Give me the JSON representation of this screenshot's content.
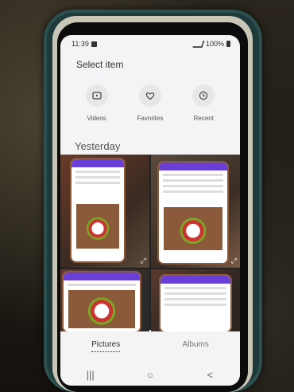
{
  "status": {
    "time": "11:39",
    "battery": "100%"
  },
  "header": {
    "title": "Select item"
  },
  "quick_actions": [
    {
      "label": "Videos",
      "icon": "video-icon"
    },
    {
      "label": "Favorites",
      "icon": "heart-icon"
    },
    {
      "label": "Recent",
      "icon": "clock-icon"
    }
  ],
  "section": {
    "title": "Yesterday"
  },
  "tabs": [
    {
      "label": "Pictures",
      "active": true
    },
    {
      "label": "Albums",
      "active": false
    }
  ],
  "nav": {
    "recent": "|||",
    "home": "○",
    "back": "<"
  },
  "colors": {
    "accent": "#6a3fd8",
    "background": "#f4f4f6",
    "case": "#1f3a3a"
  }
}
